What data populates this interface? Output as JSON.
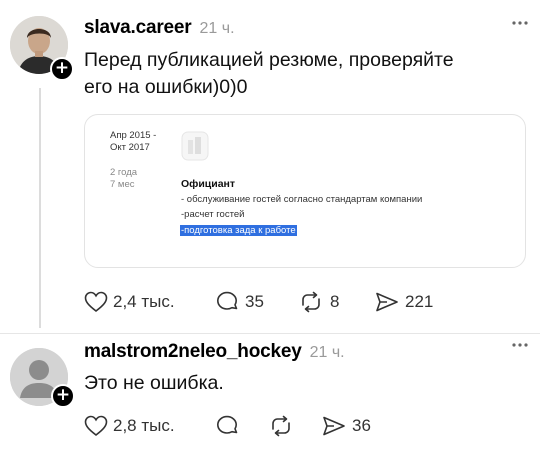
{
  "post1": {
    "username": "slava.career",
    "time": "21 ч.",
    "text_line1": "Перед публикацией  резюме, проверяйте",
    "text_line2": "его на ошибки)0)0",
    "resume": {
      "period_line1": "Апр 2015 -",
      "period_line2": "Окт 2017",
      "duration_line1": "2 года",
      "duration_line2": "7 мес",
      "position": "Официант",
      "duty1": "- обслуживание гостей согласно стандартам компании",
      "duty2": "-расчет гостей",
      "duty3": "-подготовка зада к работе"
    },
    "actions": {
      "likes": "2,4 тыс.",
      "comments": "35",
      "reposts": "8",
      "shares": "221"
    }
  },
  "post2": {
    "username": "malstrom2neleo_hockey",
    "time": "21 ч.",
    "text": "Это не ошибка.",
    "actions": {
      "likes": "2,8 тыс.",
      "shares": "36"
    }
  },
  "icons": {
    "more": "more-dots-icon",
    "like": "heart-icon",
    "comment": "speech-bubble-icon",
    "repost": "repost-arrows-icon",
    "share": "paper-plane-icon",
    "follow": "plus-icon"
  }
}
